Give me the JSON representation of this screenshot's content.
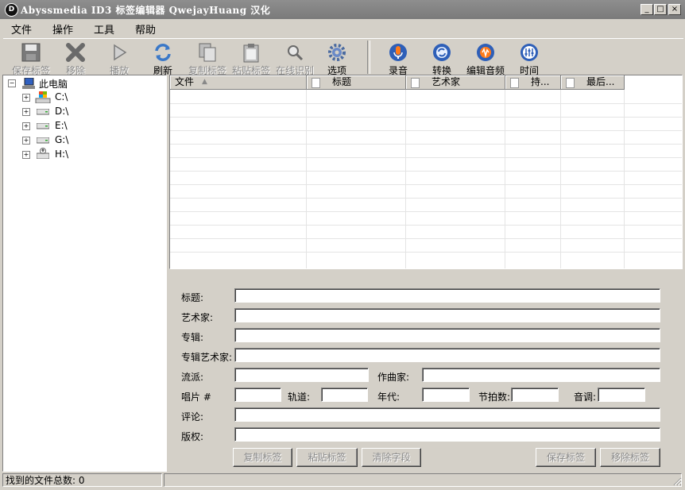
{
  "window": {
    "title": "Abyssmedia ID3 标签编辑器 QwejayHuang 汉化",
    "icon_letter": "D",
    "minimize": "_",
    "maximize": "□",
    "close": "×"
  },
  "menu": [
    "文件",
    "操作",
    "工具",
    "帮助"
  ],
  "toolbar": {
    "save_tag": "保存标签",
    "remove": "移除",
    "play": "播放",
    "refresh": "刷新",
    "copy_tag": "复制标签",
    "paste_tag": "粘贴标签",
    "online_recognize": "在线识别",
    "options": "选项",
    "record": "录音",
    "convert": "转换",
    "edit_audio": "编辑音频",
    "time": "时间"
  },
  "tree": {
    "root": "此电脑",
    "drives": [
      "C:\\",
      "D:\\",
      "E:\\",
      "G:\\",
      "H:\\"
    ]
  },
  "file_list": {
    "columns": [
      "文件",
      "标题",
      "艺术家",
      "持...",
      "最后..."
    ]
  },
  "form": {
    "title_label": "标题:",
    "artist_label": "艺术家:",
    "album_label": "专辑:",
    "album_artist_label": "专辑艺术家:",
    "genre_label": "流派:",
    "composer_label": "作曲家:",
    "disc_label": "唱片 #",
    "track_label": "轨道:",
    "year_label": "年代:",
    "bpm_label": "节拍数:",
    "key_label": "音调:",
    "comment_label": "评论:",
    "copyright_label": "版权:",
    "values": {
      "title": "",
      "artist": "",
      "album": "",
      "album_artist": "",
      "genre": "",
      "composer": "",
      "disc": "",
      "track": "",
      "year": "",
      "bpm": "",
      "key": "",
      "comment": "",
      "copyright": ""
    },
    "buttons": {
      "copy_tag": "复制标签",
      "paste_tag": "粘贴标签",
      "clear_fields": "清除字段",
      "save_tag": "保存标签",
      "remove_tag": "移除标签"
    }
  },
  "status": {
    "files_found": "找到的文件总数: 0"
  }
}
